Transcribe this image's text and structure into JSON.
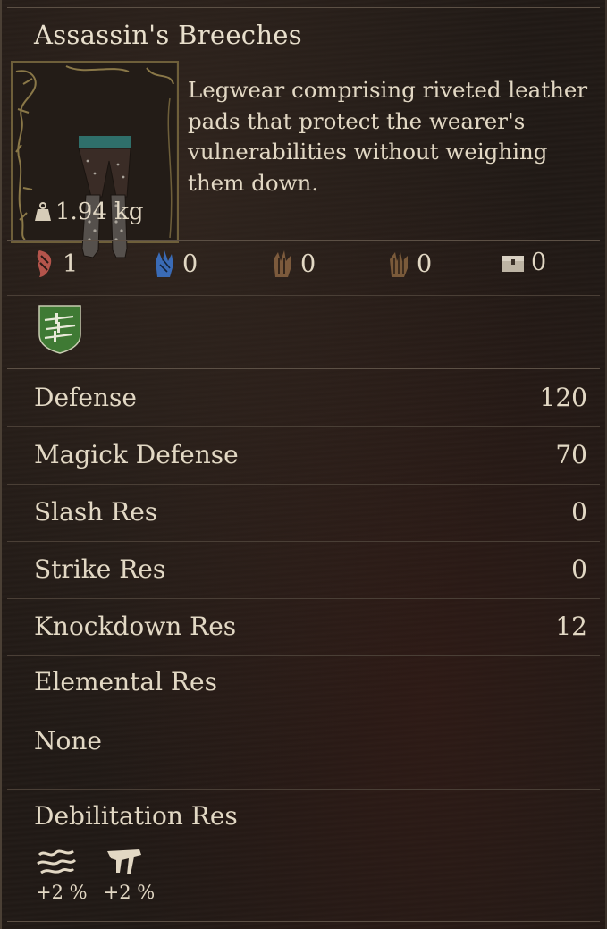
{
  "item": {
    "name": "Assassin's Breeches",
    "weight": "1.94 kg",
    "description": "Legwear comprising riveted leather pads that protect the wearer's vulnerabilities without weighing them down.",
    "icon": "leg-armor-icon"
  },
  "vocations": [
    {
      "icon": "fighter-icon",
      "value": "1",
      "color": "#b4544b"
    },
    {
      "icon": "mage-icon",
      "value": "0",
      "color": "#3a6bb6"
    },
    {
      "icon": "archer-icon",
      "value": "0",
      "color": "#7c5a3c"
    },
    {
      "icon": "warrior-icon",
      "value": "0",
      "color": "#7a5a3a"
    },
    {
      "icon": "chest-icon",
      "value": "0",
      "color": "#bdb4a4"
    }
  ],
  "vocation_badge": {
    "icon": "thief-daggers-badge-icon",
    "color": "#3f7a34"
  },
  "stats": [
    {
      "label": "Defense",
      "value": "120"
    },
    {
      "label": "Magick Defense",
      "value": "70"
    },
    {
      "label": "Slash Res",
      "value": "0"
    },
    {
      "label": "Strike Res",
      "value": "0"
    },
    {
      "label": "Knockdown Res",
      "value": "12"
    }
  ],
  "elemental": {
    "label": "Elemental Res",
    "value": "None"
  },
  "debilitation": {
    "label": "Debilitation Res",
    "items": [
      {
        "icon": "wind-icon",
        "value": "+2 %"
      },
      {
        "icon": "claw-icon",
        "value": "+2 %"
      }
    ]
  }
}
